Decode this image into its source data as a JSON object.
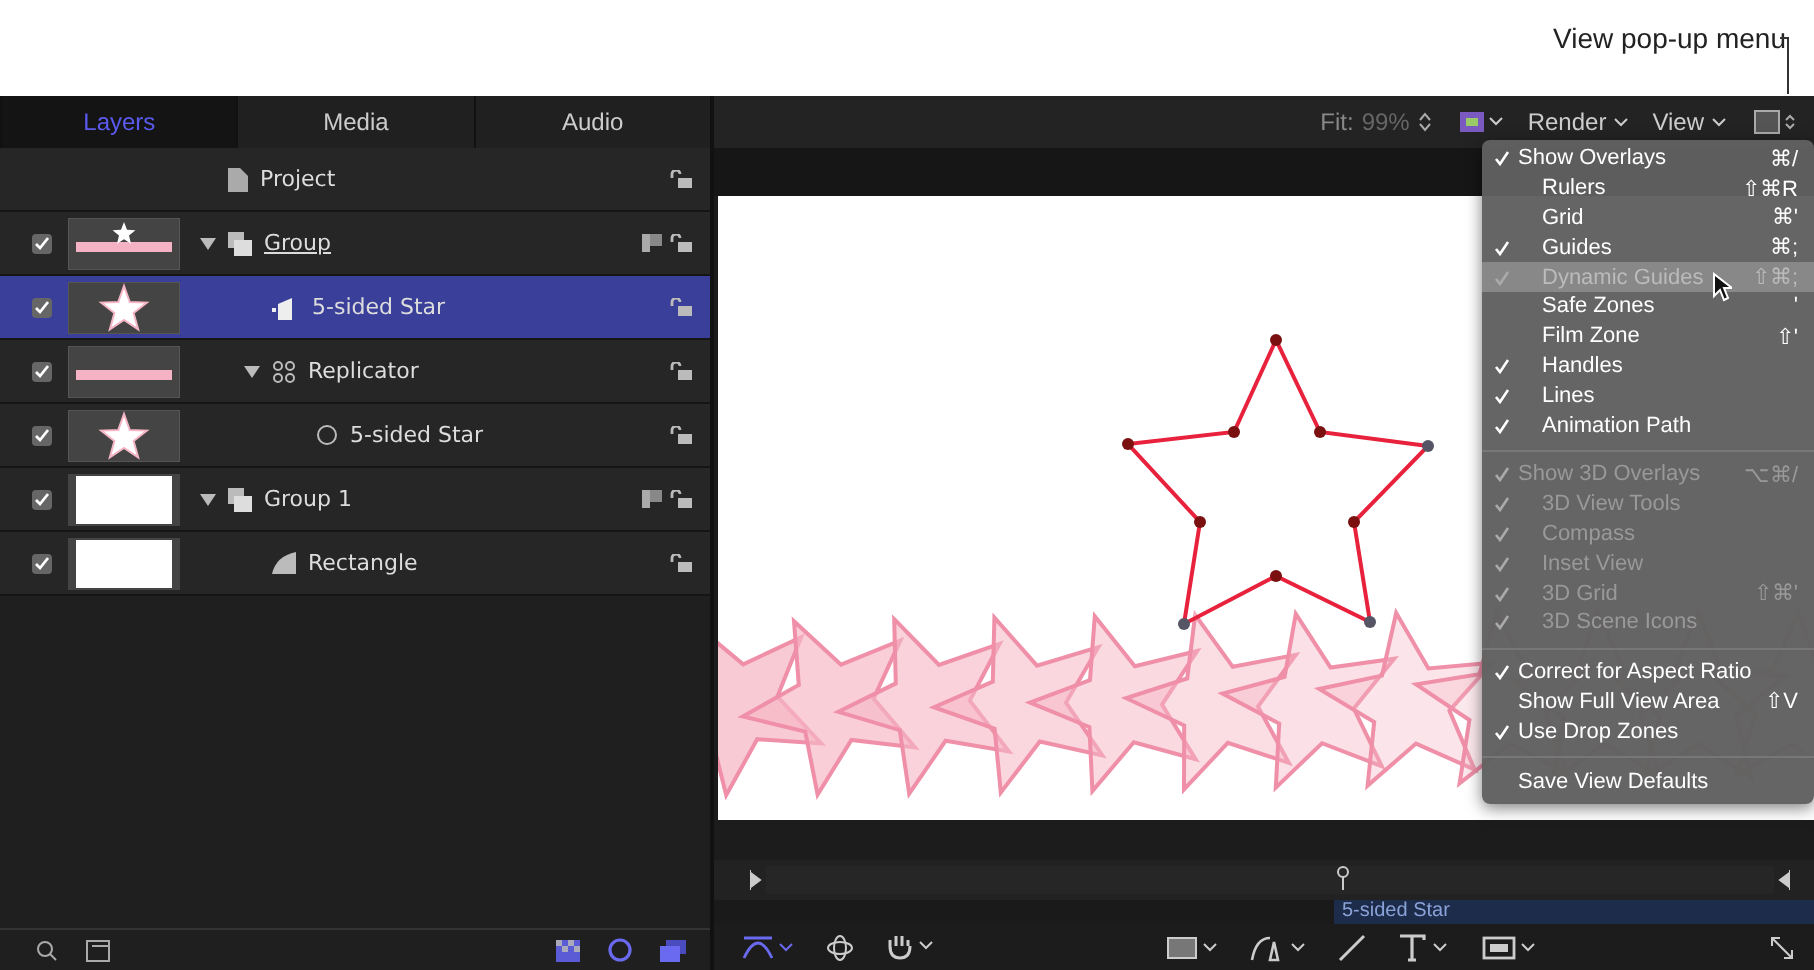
{
  "callout": {
    "label": "View pop-up menu"
  },
  "tabs": [
    {
      "label": "Layers",
      "selected": true
    },
    {
      "label": "Media",
      "selected": false
    },
    {
      "label": "Audio",
      "selected": false
    }
  ],
  "project": {
    "label": "Project"
  },
  "layers": [
    {
      "name": "Group",
      "kind": "group",
      "thumbnail": {
        "kind": "strip"
      },
      "checked": true,
      "selected": false,
      "expanded": true,
      "underlined": true,
      "children": [
        {
          "name": "5-sided Star",
          "kind": "shape",
          "thumbnail": {
            "kind": "star"
          },
          "checked": true,
          "selected": true
        },
        {
          "name": "Replicator",
          "kind": "replicator",
          "thumbnail": {
            "kind": "strip"
          },
          "checked": true,
          "selected": false,
          "expanded": true,
          "children": [
            {
              "name": "5-sided Star",
              "kind": "cell",
              "thumbnail": {
                "kind": "star"
              },
              "checked": true,
              "selected": false
            }
          ]
        }
      ]
    },
    {
      "name": "Group 1",
      "kind": "group",
      "thumbnail": {
        "kind": "blank"
      },
      "checked": true,
      "selected": false,
      "expanded": true,
      "underlined": false,
      "children": [
        {
          "name": "Rectangle",
          "kind": "rectangle",
          "thumbnail": {
            "kind": "blank"
          },
          "checked": true,
          "selected": false
        }
      ]
    }
  ],
  "toolbar": {
    "fit_label": "Fit:",
    "fit_value": "99%",
    "render": "Render",
    "view": "View"
  },
  "menu": [
    {
      "items": [
        {
          "label": "Show Overlays",
          "checked": true,
          "shortcut": "⌘/",
          "disabled": false,
          "selected": false,
          "children": [
            {
              "label": "Rulers",
              "checked": false,
              "shortcut": "⇧⌘R",
              "disabled": false,
              "selected": false
            },
            {
              "label": "Grid",
              "checked": false,
              "shortcut": "⌘'",
              "disabled": false,
              "selected": false
            },
            {
              "label": "Guides",
              "checked": true,
              "shortcut": "⌘;",
              "disabled": false,
              "selected": false
            },
            {
              "label": "Dynamic Guides",
              "checked": true,
              "shortcut": "⇧⌘;",
              "disabled": false,
              "selected": true
            },
            {
              "label": "Safe Zones",
              "checked": false,
              "shortcut": "'",
              "disabled": false,
              "selected": false
            },
            {
              "label": "Film Zone",
              "checked": false,
              "shortcut": "⇧'",
              "disabled": false,
              "selected": false
            },
            {
              "label": "Handles",
              "checked": true,
              "disabled": false,
              "selected": false
            },
            {
              "label": "Lines",
              "checked": true,
              "disabled": false,
              "selected": false
            },
            {
              "label": "Animation Path",
              "checked": true,
              "disabled": false,
              "selected": false
            }
          ]
        }
      ]
    },
    {
      "items": [
        {
          "label": "Show 3D Overlays",
          "checked": true,
          "shortcut": "⌥⌘/",
          "disabled": true,
          "selected": false,
          "children": [
            {
              "label": "3D View Tools",
              "checked": true,
              "disabled": true,
              "selected": false
            },
            {
              "label": "Compass",
              "checked": true,
              "disabled": true,
              "selected": false
            },
            {
              "label": "Inset View",
              "checked": true,
              "disabled": true,
              "selected": false
            },
            {
              "label": "3D Grid",
              "checked": true,
              "shortcut": "⇧⌘'",
              "disabled": true,
              "selected": false
            },
            {
              "label": "3D Scene Icons",
              "checked": true,
              "disabled": true,
              "selected": false
            }
          ]
        }
      ]
    },
    {
      "items": [
        {
          "label": "Correct for Aspect Ratio",
          "checked": true,
          "disabled": false,
          "selected": false
        },
        {
          "label": "Show Full View Area",
          "checked": false,
          "shortcut": "⇧V",
          "disabled": false,
          "selected": false
        },
        {
          "label": "Use Drop Zones",
          "checked": true,
          "disabled": false,
          "selected": false
        }
      ]
    },
    {
      "items": [
        {
          "label": "Save View Defaults",
          "checked": false,
          "disabled": false,
          "selected": false
        }
      ]
    }
  ],
  "timeline": {
    "bar_label": "5-sided Star"
  }
}
